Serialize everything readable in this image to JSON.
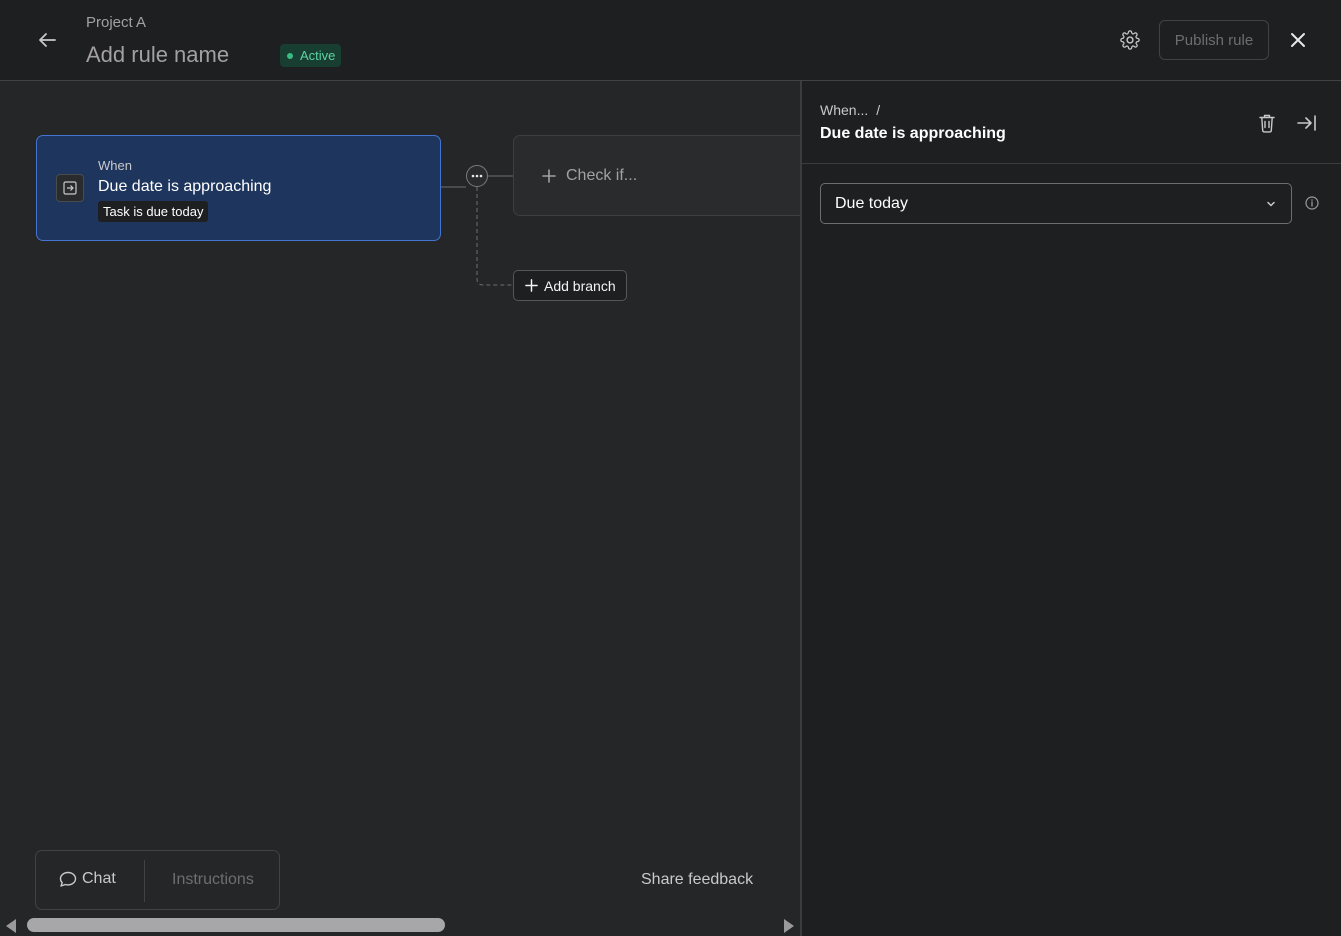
{
  "header": {
    "project": "Project A",
    "rule_name": "Add rule name",
    "status": "Active",
    "publish_label": "Publish rule"
  },
  "canvas": {
    "trigger": {
      "when_label": "When",
      "title": "Due date is approaching",
      "chip": "Task is due today"
    },
    "check_label": "Check if...",
    "add_branch_label": "Add branch"
  },
  "bottom": {
    "chat_label": "Chat",
    "instructions_label": "Instructions",
    "share_feedback": "Share feedback"
  },
  "panel": {
    "crumb": "When...",
    "crumb_sep": "/",
    "title": "Due date is approaching",
    "select_value": "Due today"
  },
  "icons": {
    "back": "arrow-left-icon",
    "settings": "gear-icon",
    "close": "close-icon",
    "trigger": "trigger-enter-icon",
    "more": "ellipsis-icon",
    "add": "plus-icon",
    "chat": "chat-bubble-icon",
    "delete": "trash-icon",
    "collapse": "collapse-panel-icon",
    "chevron": "chevron-down-icon",
    "info": "info-icon"
  },
  "colors": {
    "accent": "#4573d2",
    "active_badge": "#173e30",
    "active_text": "#5dd3a4"
  }
}
